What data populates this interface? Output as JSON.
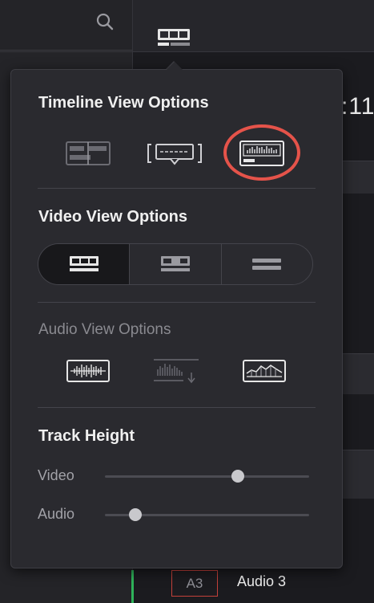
{
  "background": {
    "timecode": ":11",
    "track": {
      "id": "A3",
      "name": "Audio 3"
    }
  },
  "popover": {
    "timeline_title": "Timeline View Options",
    "video_title": "Video View Options",
    "audio_title": "Audio View Options",
    "track_height_title": "Track Height",
    "timeline_options": [
      "stacked-timelines-icon",
      "subtitle-tracks-icon",
      "audio-waveform-view-icon"
    ],
    "highlighted_option": "audio-waveform-view-icon",
    "highlight_color": "#e5534a",
    "video_options": [
      "large-thumbnail-view-icon",
      "small-thumbnail-view-icon",
      "simple-view-icon"
    ],
    "video_selected": 0,
    "audio_options": [
      "audio-waveform-icon",
      "audio-waveform-split-icon",
      "audio-waveform-overlay-icon"
    ],
    "video_slider": {
      "label": "Video",
      "value": 0.65
    },
    "audio_slider": {
      "label": "Audio",
      "value": 0.15
    }
  }
}
